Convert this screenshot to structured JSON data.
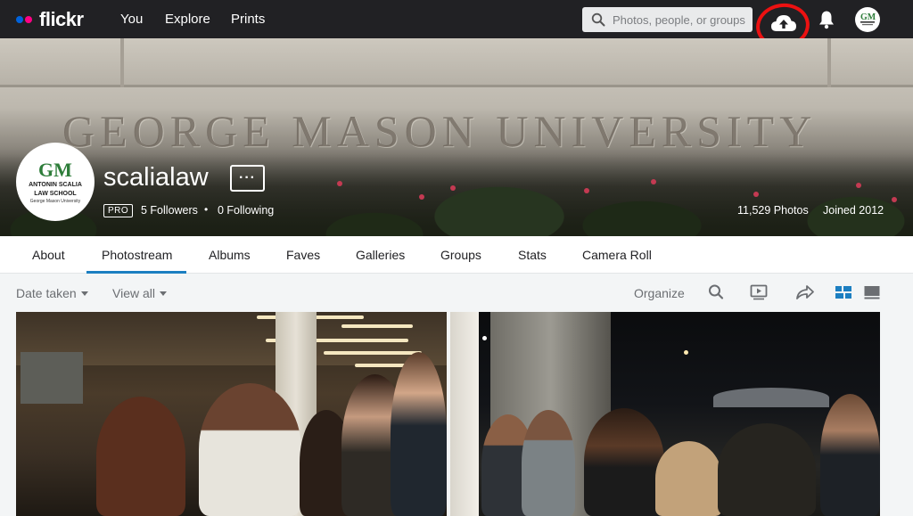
{
  "nav": {
    "logo_text": "flickr",
    "logo_dot_colors": [
      "#0063dc",
      "#ff0084"
    ],
    "links": [
      "You",
      "Explore",
      "Prints"
    ],
    "search_placeholder": "Photos, people, or groups",
    "icons": [
      "search-icon",
      "upload-cloud-icon",
      "bell-icon",
      "avatar"
    ]
  },
  "cover": {
    "engraving": "GEORGE MASON UNIVERSITY",
    "avatar": {
      "mark": "GM",
      "school_line1": "ANTONIN SCALIA",
      "school_line2": "LAW SCHOOL",
      "school_sub": "George Mason University"
    },
    "username": "scalialaw",
    "more_label": "···",
    "pro_badge": "PRO",
    "followers": "5 Followers",
    "following": "0 Following",
    "photos_count": "11,529 Photos",
    "joined": "Joined 2012"
  },
  "tabs": [
    "About",
    "Photostream",
    "Albums",
    "Faves",
    "Galleries",
    "Groups",
    "Stats",
    "Camera Roll"
  ],
  "active_tab": "Photostream",
  "toolbar": {
    "date_taken": "Date taken",
    "view_all": "View all",
    "organize": "Organize",
    "icons": [
      "search-icon",
      "slideshow-icon",
      "share-icon",
      "grid-view-icon",
      "list-view-icon"
    ]
  },
  "colors": {
    "topbar": "#212124",
    "accent": "#1c7fc1",
    "annotation": "#ec1111"
  }
}
